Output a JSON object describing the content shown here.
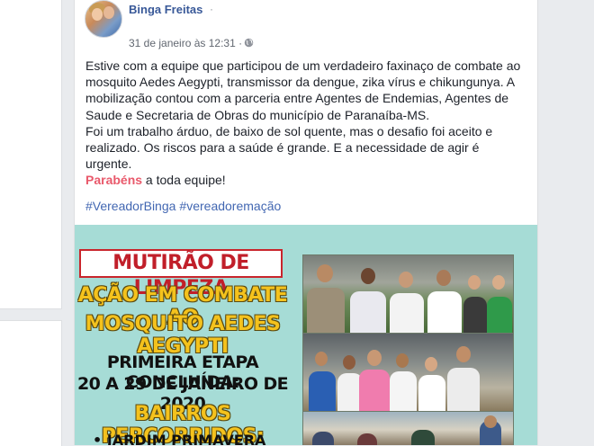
{
  "post": {
    "author": "Binga Freitas",
    "author_dot": "·",
    "timestamp": "31 de janeiro às 12:31 ·",
    "text_lines": [
      "Estive com a equipe que participou de um verdadeiro faxinaço de combate ao mosquito Aedes Aegypti, transmissor da dengue, zika vírus e chikungunya. A mobilização contou com a parceria entre Agentes de Endemias, Agentes de Saude e Secretaria de Obras do município de Paranaíba-MS.",
      "Foi um trabalho árduo, de baixo de sol quente, mas o desafio foi aceito e realizado. Os riscos para a saúde é grande. E a necessidade de agir é urgente."
    ],
    "congrats_highlight": "Parabéns",
    "congrats_rest": " a toda equipe!",
    "hashtags": [
      "#VereadorBinga",
      "#vereadoremação"
    ]
  },
  "flyer": {
    "title": "MUTIRÃO DE LIMPEZA",
    "subtitle_line1": "AÇÃO EM COMBATE AO",
    "subtitle_line2": "MOSQUITO AEDES AEGYPTI",
    "stage_line1": "PRIMEIRA ETAPA CONCLUÍDA:",
    "stage_line2": "20 A 29 DE JANEIRO DE 2020",
    "neighborhoods_title": "BAIRROS PERCORRIDOS:",
    "first_neighborhood": "• JARDIM PRIMAVERA"
  },
  "icons": {
    "globe": "globe-icon",
    "avatar": "profile-avatar"
  },
  "colors": {
    "author": "#385898",
    "hashtag": "#4267b2",
    "congrats": "#e9596b",
    "flyer_bg": "#a6dcd6",
    "flyer_title_red": "#c11f2a",
    "flyer_yellow": "#f4c21d"
  }
}
